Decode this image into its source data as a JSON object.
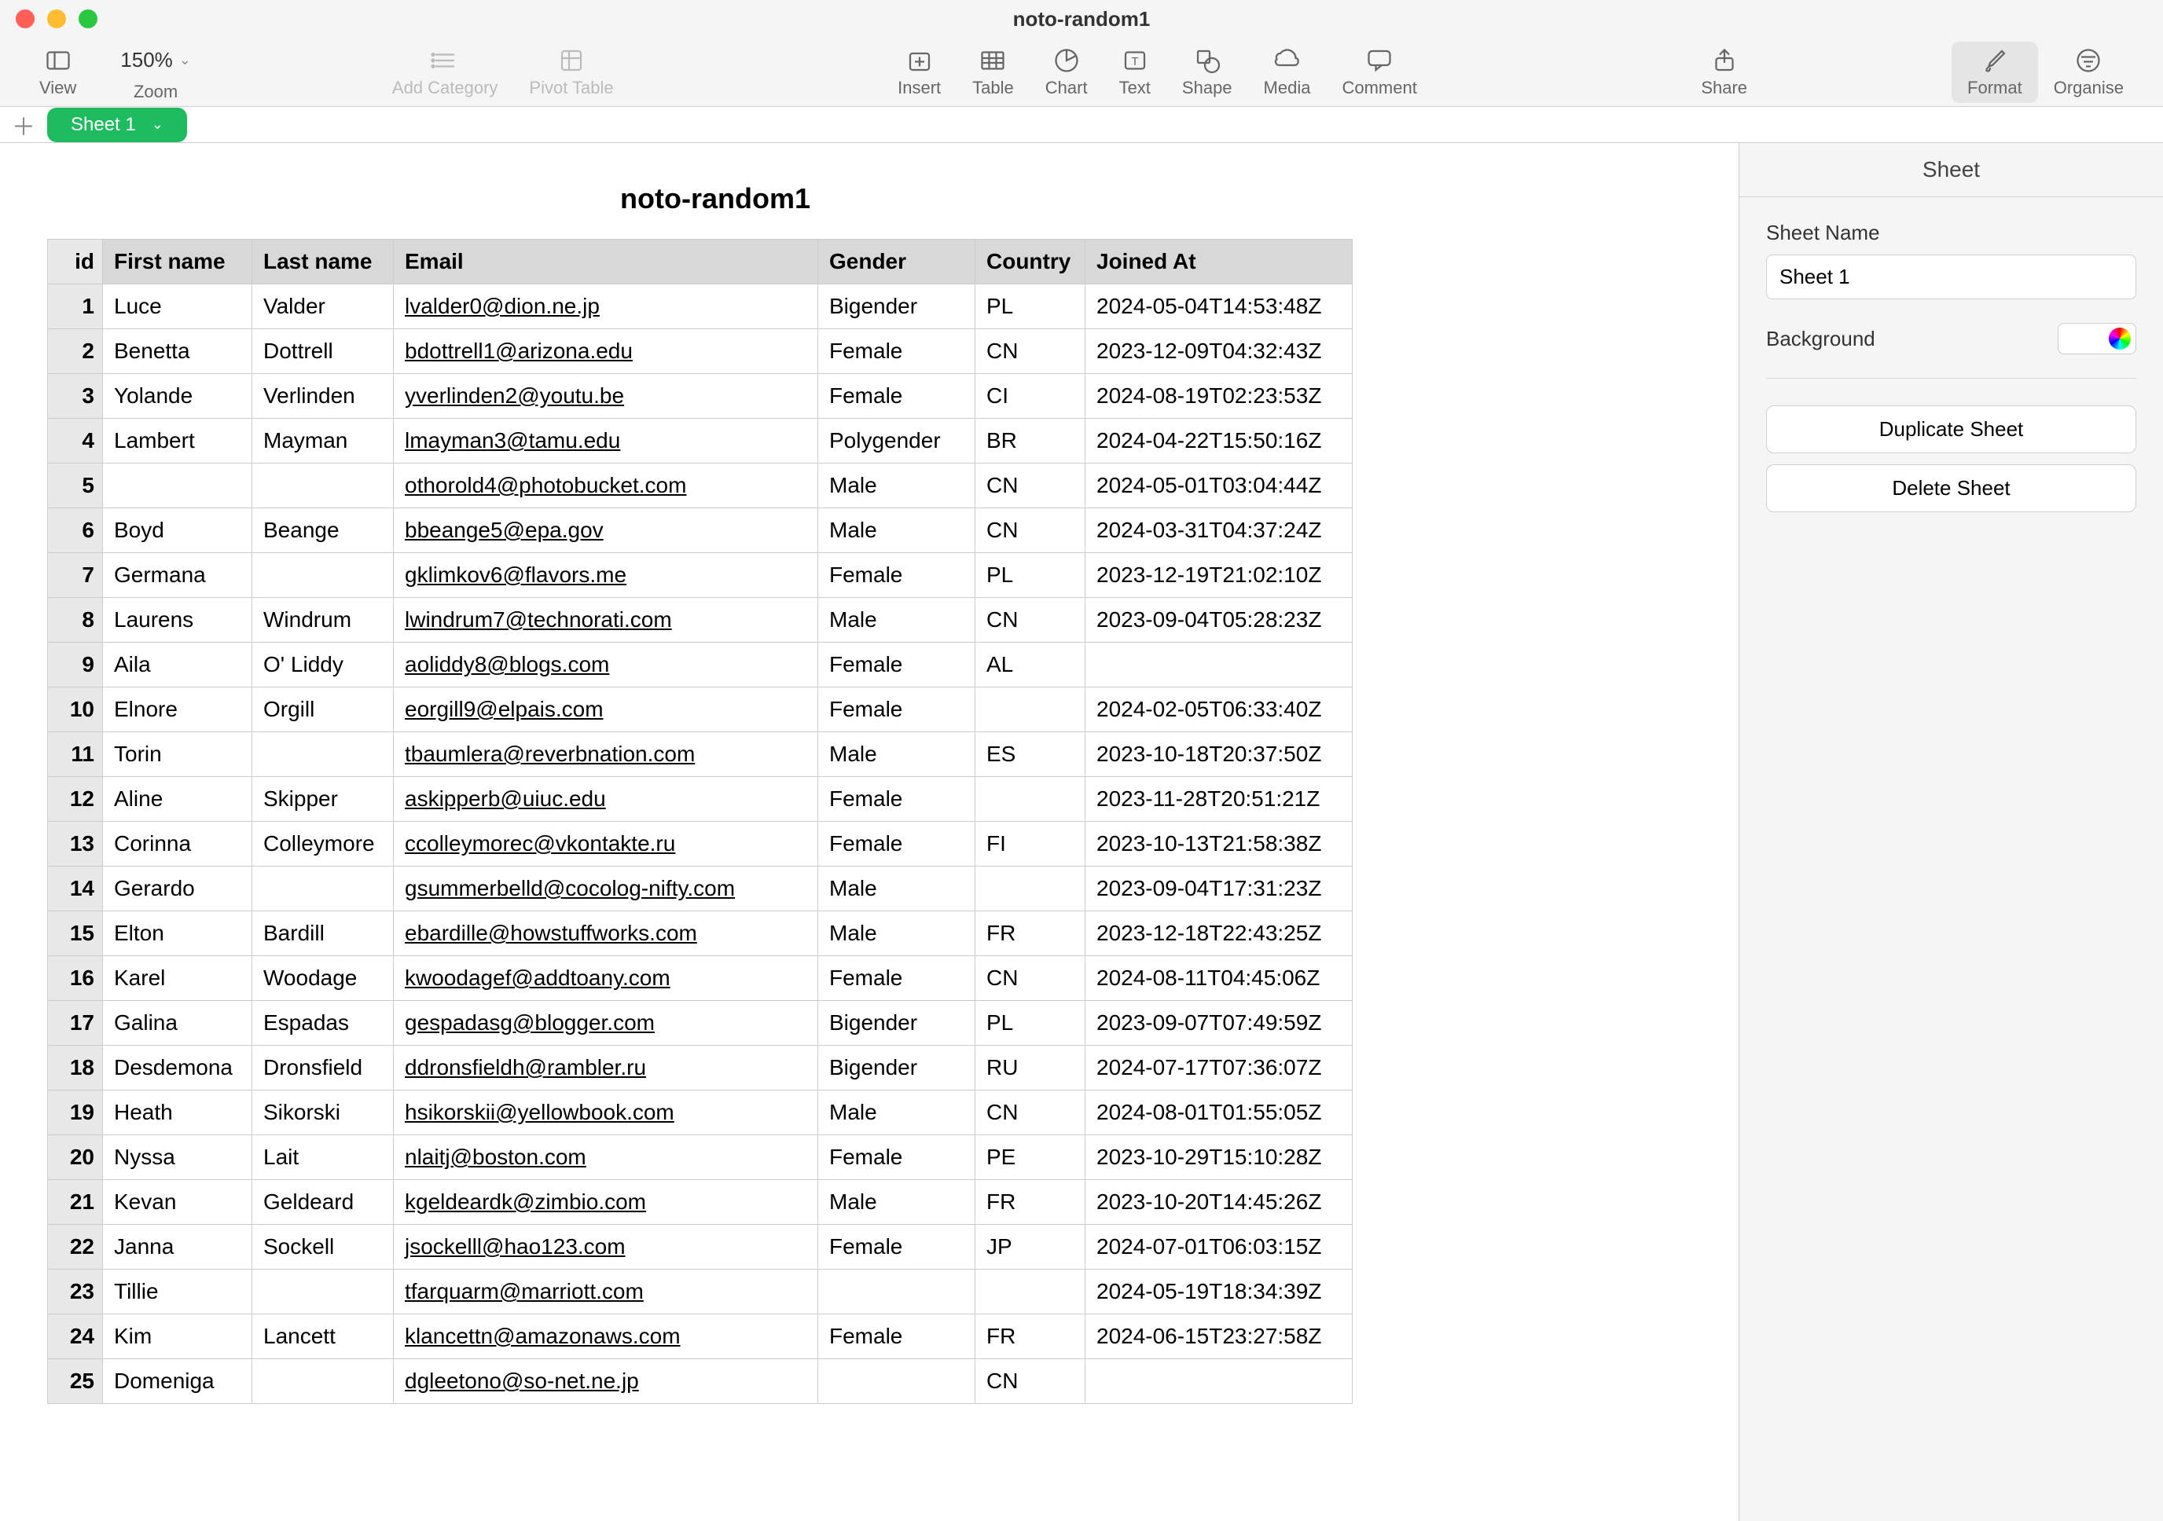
{
  "window": {
    "title": "noto-random1"
  },
  "toolbar": {
    "view": "View",
    "zoom_value": "150%",
    "zoom": "Zoom",
    "add_category": "Add Category",
    "pivot_table": "Pivot Table",
    "insert": "Insert",
    "table": "Table",
    "chart": "Chart",
    "text": "Text",
    "shape": "Shape",
    "media": "Media",
    "comment": "Comment",
    "share": "Share",
    "format": "Format",
    "organise": "Organise"
  },
  "sheet_tab": "Sheet 1",
  "table": {
    "title": "noto-random1",
    "headers": [
      "id",
      "First name",
      "Last name",
      "Email",
      "Gender",
      "Country",
      "Joined At"
    ],
    "rows": [
      {
        "id": "1",
        "first": "Luce",
        "last": "Valder",
        "email": "lvalder0@dion.ne.jp",
        "gender": "Bigender",
        "country": "PL",
        "joined": "2024-05-04T14:53:48Z"
      },
      {
        "id": "2",
        "first": "Benetta",
        "last": "Dottrell",
        "email": "bdottrell1@arizona.edu",
        "gender": "Female",
        "country": "CN",
        "joined": "2023-12-09T04:32:43Z"
      },
      {
        "id": "3",
        "first": "Yolande",
        "last": "Verlinden",
        "email": "yverlinden2@youtu.be",
        "gender": "Female",
        "country": "CI",
        "joined": "2024-08-19T02:23:53Z"
      },
      {
        "id": "4",
        "first": "Lambert",
        "last": "Mayman",
        "email": "lmayman3@tamu.edu",
        "gender": "Polygender",
        "country": "BR",
        "joined": "2024-04-22T15:50:16Z"
      },
      {
        "id": "5",
        "first": "",
        "last": "",
        "email": "othorold4@photobucket.com",
        "gender": "Male",
        "country": "CN",
        "joined": "2024-05-01T03:04:44Z"
      },
      {
        "id": "6",
        "first": "Boyd",
        "last": "Beange",
        "email": "bbeange5@epa.gov",
        "gender": "Male",
        "country": "CN",
        "joined": "2024-03-31T04:37:24Z"
      },
      {
        "id": "7",
        "first": "Germana",
        "last": "",
        "email": "gklimkov6@flavors.me",
        "gender": "Female",
        "country": "PL",
        "joined": "2023-12-19T21:02:10Z"
      },
      {
        "id": "8",
        "first": "Laurens",
        "last": "Windrum",
        "email": "lwindrum7@technorati.com",
        "gender": "Male",
        "country": "CN",
        "joined": "2023-09-04T05:28:23Z"
      },
      {
        "id": "9",
        "first": "Aila",
        "last": "O' Liddy",
        "email": "aoliddy8@blogs.com",
        "gender": "Female",
        "country": "AL",
        "joined": ""
      },
      {
        "id": "10",
        "first": "Elnore",
        "last": "Orgill",
        "email": "eorgill9@elpais.com",
        "gender": "Female",
        "country": "",
        "joined": "2024-02-05T06:33:40Z"
      },
      {
        "id": "11",
        "first": "Torin",
        "last": "",
        "email": "tbaumlera@reverbnation.com",
        "gender": "Male",
        "country": "ES",
        "joined": "2023-10-18T20:37:50Z"
      },
      {
        "id": "12",
        "first": "Aline",
        "last": "Skipper",
        "email": "askipperb@uiuc.edu",
        "gender": "Female",
        "country": "",
        "joined": "2023-11-28T20:51:21Z"
      },
      {
        "id": "13",
        "first": "Corinna",
        "last": "Colleymore",
        "email": "ccolleymorec@vkontakte.ru",
        "gender": "Female",
        "country": "FI",
        "joined": "2023-10-13T21:58:38Z"
      },
      {
        "id": "14",
        "first": "Gerardo",
        "last": "",
        "email": "gsummerbelld@cocolog-nifty.com",
        "gender": "Male",
        "country": "",
        "joined": "2023-09-04T17:31:23Z"
      },
      {
        "id": "15",
        "first": "Elton",
        "last": "Bardill",
        "email": "ebardille@howstuffworks.com",
        "gender": "Male",
        "country": "FR",
        "joined": "2023-12-18T22:43:25Z"
      },
      {
        "id": "16",
        "first": "Karel",
        "last": "Woodage",
        "email": "kwoodagef@addtoany.com",
        "gender": "Female",
        "country": "CN",
        "joined": "2024-08-11T04:45:06Z"
      },
      {
        "id": "17",
        "first": "Galina",
        "last": "Espadas",
        "email": "gespadasg@blogger.com",
        "gender": "Bigender",
        "country": "PL",
        "joined": "2023-09-07T07:49:59Z"
      },
      {
        "id": "18",
        "first": "Desdemona",
        "last": "Dronsfield",
        "email": "ddronsfieldh@rambler.ru",
        "gender": "Bigender",
        "country": "RU",
        "joined": "2024-07-17T07:36:07Z"
      },
      {
        "id": "19",
        "first": "Heath",
        "last": "Sikorski",
        "email": "hsikorskii@yellowbook.com",
        "gender": "Male",
        "country": "CN",
        "joined": "2024-08-01T01:55:05Z"
      },
      {
        "id": "20",
        "first": "Nyssa",
        "last": "Lait",
        "email": "nlaitj@boston.com",
        "gender": "Female",
        "country": "PE",
        "joined": "2023-10-29T15:10:28Z"
      },
      {
        "id": "21",
        "first": "Kevan",
        "last": "Geldeard",
        "email": "kgeldeardk@zimbio.com",
        "gender": "Male",
        "country": "FR",
        "joined": "2023-10-20T14:45:26Z"
      },
      {
        "id": "22",
        "first": "Janna",
        "last": "Sockell",
        "email": "jsockelll@hao123.com",
        "gender": "Female",
        "country": "JP",
        "joined": "2024-07-01T06:03:15Z"
      },
      {
        "id": "23",
        "first": "Tillie",
        "last": "",
        "email": "tfarquarm@marriott.com",
        "gender": "",
        "country": "",
        "joined": "2024-05-19T18:34:39Z"
      },
      {
        "id": "24",
        "first": "Kim",
        "last": "Lancett",
        "email": "klancettn@amazonaws.com",
        "gender": "Female",
        "country": "FR",
        "joined": "2024-06-15T23:27:58Z"
      },
      {
        "id": "25",
        "first": "Domeniga",
        "last": "",
        "email": "dgleetono@so-net.ne.jp",
        "gender": "",
        "country": "CN",
        "joined": ""
      }
    ]
  },
  "inspector": {
    "tab": "Sheet",
    "sheet_name_label": "Sheet Name",
    "sheet_name_value": "Sheet 1",
    "background_label": "Background",
    "duplicate": "Duplicate Sheet",
    "delete": "Delete Sheet"
  }
}
